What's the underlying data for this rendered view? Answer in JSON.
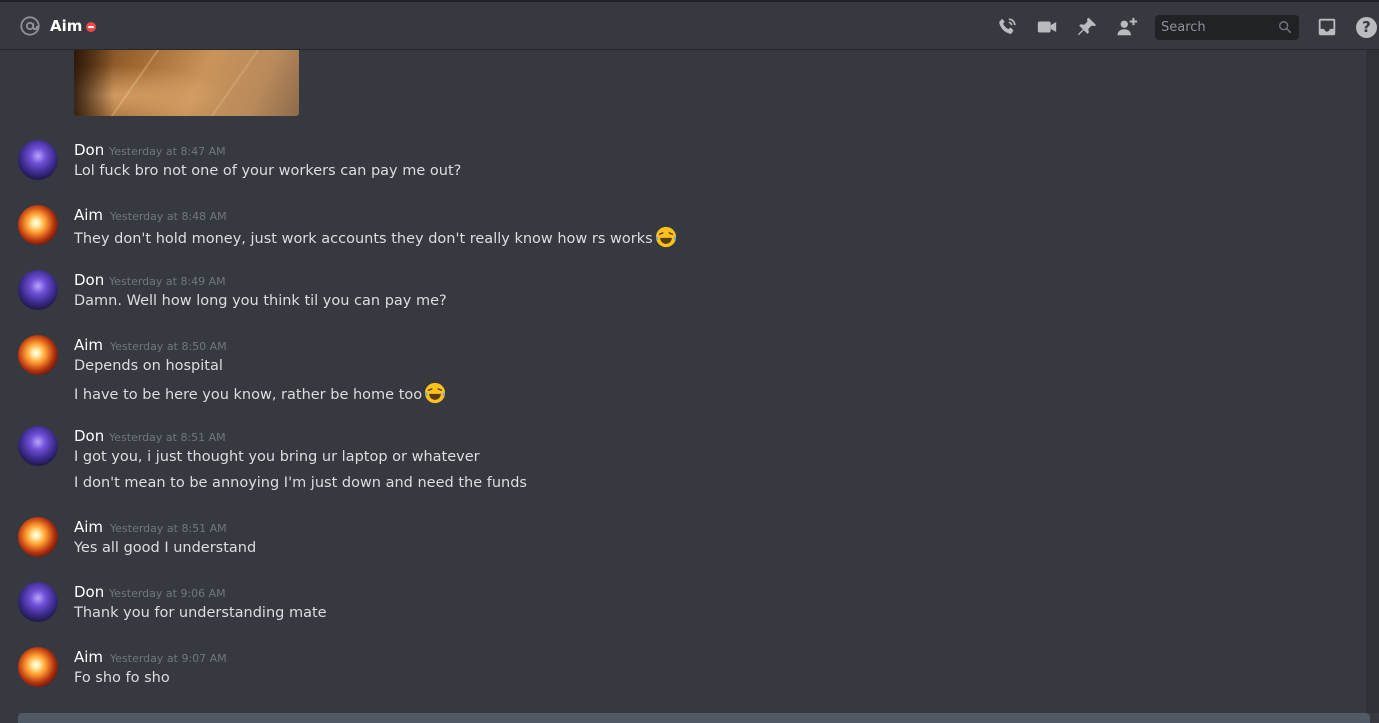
{
  "header": {
    "channel_name": "Aim",
    "status": "dnd",
    "search_placeholder": "Search",
    "icons": [
      "at-icon",
      "phone-call-icon",
      "video-call-icon",
      "pin-icon",
      "add-friend-icon",
      "search-icon",
      "inbox-icon",
      "help-icon"
    ],
    "help_glyph": "?"
  },
  "colors": {
    "background": "#36393f",
    "header_border": "#202225",
    "username": "#ffffff",
    "text": "#dcddde",
    "timestamp": "#72767d",
    "dnd": "#f04747",
    "search_bg": "#202225"
  },
  "messages": [
    {
      "author": "Don",
      "timestamp": "Yesterday at 8:47 AM",
      "lines": [
        "Lol fuck bro not one of your workers can pay me out?"
      ]
    },
    {
      "author": "Aim",
      "timestamp": "Yesterday at 8:48 AM",
      "lines": [
        "They don't hold money, just work accounts  they don't really know how rs works"
      ],
      "emoji": "joy"
    },
    {
      "author": "Don",
      "timestamp": "Yesterday at 8:49 AM",
      "lines": [
        "Damn. Well how long you think til you can pay me?"
      ]
    },
    {
      "author": "Aim",
      "timestamp": "Yesterday at 8:50 AM",
      "lines": [
        "Depends on hospital",
        "I have to be here you know, rather be home too"
      ],
      "emoji": "joy"
    },
    {
      "author": "Don",
      "timestamp": "Yesterday at 8:51 AM",
      "lines": [
        "I got you, i just thought you bring ur laptop or whatever",
        "I don't mean to be annoying I'm just down and need the funds"
      ]
    },
    {
      "author": "Aim",
      "timestamp": "Yesterday at 8:51 AM",
      "lines": [
        "Yes all good I understand"
      ]
    },
    {
      "author": "Don",
      "timestamp": "Yesterday at 9:06 AM",
      "lines": [
        "Thank you for understanding mate"
      ]
    },
    {
      "author": "Aim",
      "timestamp": "Yesterday at 9:07 AM",
      "lines": [
        "Fo sho fo sho"
      ]
    }
  ]
}
